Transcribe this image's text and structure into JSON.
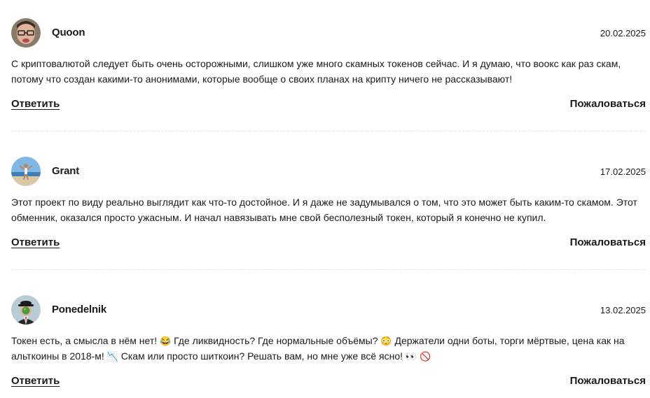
{
  "comments": [
    {
      "author": "Quoon",
      "date": "20.02.2025",
      "text": "С криптовалютой следует быть очень осторожными, слишком уже много скамных токенов сейчас. И я думаю, что воокс как раз скам, потому что создан какими-то анонимами, которые вообще о своих планах на крипту ничего не рассказывают!",
      "reply_label": "Ответить",
      "report_label": "Пожаловаться"
    },
    {
      "author": "Grant",
      "date": "17.02.2025",
      "text": "Этот проект по виду реально выглядит как что-то достойное. И я даже не задумывался о том, что это может быть каким-то скамом. Этот обменник, оказался просто ужасным. И начал навязывать мне свой бесполезный токен, который я конечно не купил.",
      "reply_label": "Ответить",
      "report_label": "Пожаловаться"
    },
    {
      "author": "Ponedelnik",
      "date": "13.02.2025",
      "text_parts": [
        "Токен есть, а смысла в нём нет! ",
        "😂",
        " Где ликвидность? Где нормальные объёмы? ",
        "😳",
        " Держатели одни боты, торги мёртвые, цена как на альткоины в 2018-м! ",
        "📉",
        " Скам или просто шиткоин? Решать вам, но мне уже всё ясно! ",
        "👀",
        " ",
        "🚫"
      ],
      "reply_label": "Ответить",
      "report_label": "Пожаловаться"
    }
  ]
}
